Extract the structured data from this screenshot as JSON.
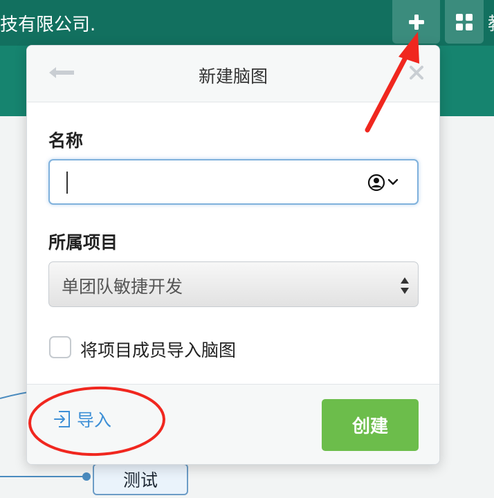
{
  "header": {
    "company_text": "技有限公司.",
    "edge_char": "教",
    "colors": {
      "bar": "#12705f",
      "subbar": "#16846f",
      "button": "#3b8c7d"
    }
  },
  "toolbar": {
    "add_icon": "plus-icon",
    "apps_icon": "grid-icon"
  },
  "dialog": {
    "title": "新建脑图",
    "back_icon": "arrow-left-icon",
    "close_icon": "close-icon",
    "name_label": "名称",
    "name_value": "",
    "name_icon": "persona-chevron-icon",
    "project_label": "所属项目",
    "project_value": "单团队敏捷开发",
    "project_options": [
      "单团队敏捷开发"
    ],
    "import_members_label": "将项目成员导入脑图",
    "import_members_checked": false,
    "import_label": "导入",
    "import_icon": "import-icon",
    "create_label": "创建",
    "colors": {
      "create": "#6cbd4b",
      "import": "#3d8fd6"
    }
  },
  "canvas": {
    "node_label": "测试",
    "colors": {
      "connector": "#4a8bbf"
    }
  },
  "annotations": {
    "color": "#f0271f",
    "items": [
      "arrow-to-add-button",
      "circle-around-import"
    ]
  }
}
